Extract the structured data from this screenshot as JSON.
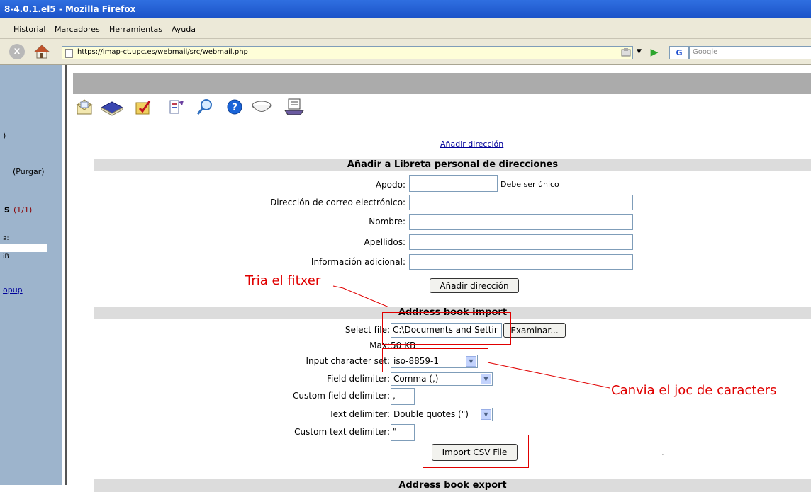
{
  "browser": {
    "title": "8-4.0.1.el5 - Mozilla Firefox",
    "menu": [
      "Historial",
      "Marcadores",
      "Herramientas",
      "Ayuda"
    ],
    "url": "https://imap-ct.upc.es/webmail/src/webmail.php",
    "search_placeholder": "Google",
    "search_engine_label": "G",
    "stop_icon": "x",
    "go_icon": "▶",
    "dropdown_icon": "▼"
  },
  "sidebar": {
    "paren": ")",
    "purgar": "(Purgar)",
    "folder": "s",
    "folder_count": "(1/1)",
    "colon": "a:",
    "size": "iB",
    "popup": "opup"
  },
  "toolbar_icons": [
    "compose-icon",
    "addresses-icon",
    "folders-icon",
    "options-icon",
    "search-icon",
    "help-icon",
    "bowl-icon",
    "calendar-icon"
  ],
  "top_link": "Añadir dirección",
  "add_section": {
    "title": "Añadir a Libreta personal de direcciones",
    "fields": [
      {
        "label": "Apodo:",
        "value": ""
      },
      {
        "label": "Dirección de correo electrónico:",
        "value": ""
      },
      {
        "label": "Nombre:",
        "value": ""
      },
      {
        "label": "Apellidos:",
        "value": ""
      },
      {
        "label": "Información adicional:",
        "value": ""
      }
    ],
    "nick_hint": "Debe ser único",
    "submit": "Añadir dirección"
  },
  "import_section": {
    "title": "Address book import",
    "select_file_label": "Select file:",
    "select_file_value": "C:\\Documents and Settir",
    "browse_button": "Examinar...",
    "max_label": "Max:",
    "max_value": "50 KB",
    "charset_label": "Input character set:",
    "charset_value": "iso-8859-1",
    "field_delim_label": "Field delimiter:",
    "field_delim_value": "Comma (,)",
    "custom_field_delim_label": "Custom field delimiter:",
    "custom_field_delim_value": ",",
    "text_delim_label": "Text delimiter:",
    "text_delim_value": "Double quotes (\")",
    "custom_text_delim_label": "Custom text delimiter:",
    "custom_text_delim_value": "\"",
    "import_button": "Import CSV File"
  },
  "export_section": {
    "title": "Address book export"
  },
  "annotations": {
    "choose_file": "Tria el fitxer",
    "change_charset": "Canvia el joc de caracters"
  },
  "colors": {
    "annotation_red": "#e00000",
    "sidebar_blue": "#9db4cc",
    "header_gray": "#dcdcdc"
  }
}
